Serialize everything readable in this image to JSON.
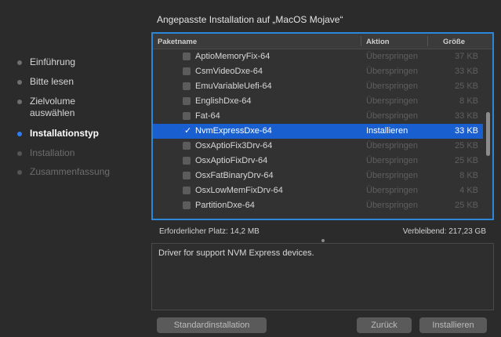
{
  "sidebar": {
    "steps": [
      {
        "label": "Einführung",
        "state": "done"
      },
      {
        "label": "Bitte lesen",
        "state": "done"
      },
      {
        "label": "Zielvolume auswählen",
        "state": "done"
      },
      {
        "label": "Installationstyp",
        "state": "active"
      },
      {
        "label": "Installation",
        "state": "pending"
      },
      {
        "label": "Zusammenfassung",
        "state": "pending"
      }
    ]
  },
  "title": "Angepasste Installation auf „MacOS Mojave“",
  "table": {
    "headers": {
      "name": "Paketname",
      "action": "Aktion",
      "size": "Größe"
    },
    "rows": [
      {
        "name": "AptioMemoryFix-64",
        "action": "Überspringen",
        "size": "37 KB",
        "checked": false
      },
      {
        "name": "CsmVideoDxe-64",
        "action": "Überspringen",
        "size": "33 KB",
        "checked": false
      },
      {
        "name": "EmuVariableUefi-64",
        "action": "Überspringen",
        "size": "25 KB",
        "checked": false
      },
      {
        "name": "EnglishDxe-64",
        "action": "Überspringen",
        "size": "8 KB",
        "checked": false
      },
      {
        "name": "Fat-64",
        "action": "Überspringen",
        "size": "33 KB",
        "checked": false
      },
      {
        "name": "NvmExpressDxe-64",
        "action": "Installieren",
        "size": "33 KB",
        "checked": true,
        "selected": true
      },
      {
        "name": "OsxAptioFix3Drv-64",
        "action": "Überspringen",
        "size": "25 KB",
        "checked": false
      },
      {
        "name": "OsxAptioFixDrv-64",
        "action": "Überspringen",
        "size": "25 KB",
        "checked": false
      },
      {
        "name": "OsxFatBinaryDrv-64",
        "action": "Überspringen",
        "size": "8 KB",
        "checked": false
      },
      {
        "name": "OsxLowMemFixDrv-64",
        "action": "Überspringen",
        "size": "4 KB",
        "checked": false
      },
      {
        "name": "PartitionDxe-64",
        "action": "Überspringen",
        "size": "25 KB",
        "checked": false
      }
    ]
  },
  "info": {
    "required_label": "Erforderlicher Platz:",
    "required_value": "14,2 MB",
    "remaining_label": "Verbleibend:",
    "remaining_value": "217,23 GB"
  },
  "description": "Driver for support NVM Express devices.",
  "buttons": {
    "standard": "Standardinstallation",
    "back": "Zurück",
    "install": "Installieren"
  },
  "colors": {
    "accent": "#1a5fd0",
    "background": "#2b2b2c",
    "focus_ring": "#2c86d9"
  }
}
